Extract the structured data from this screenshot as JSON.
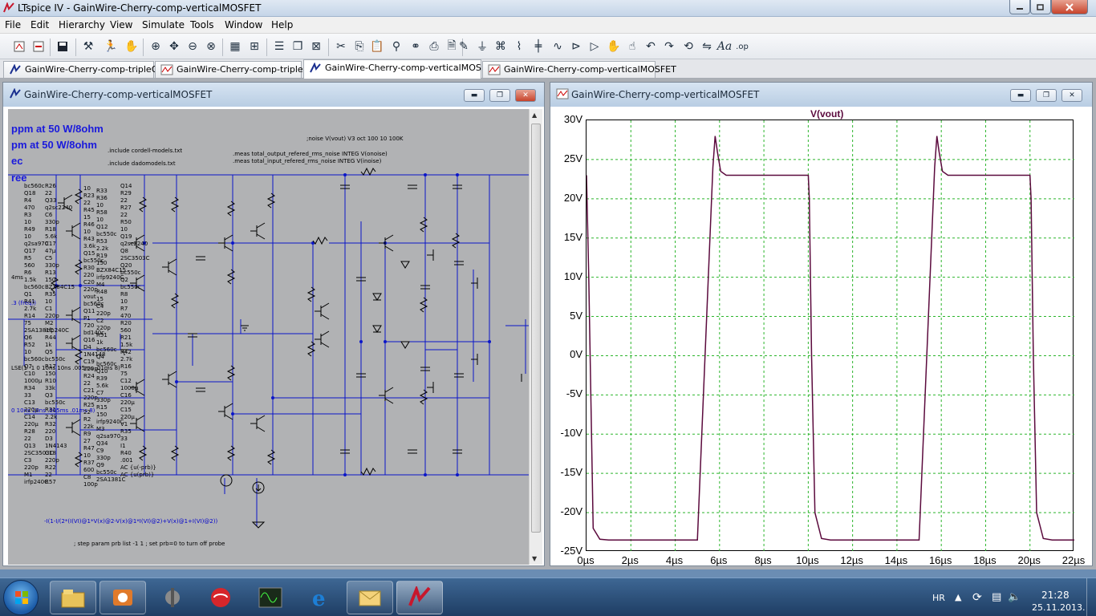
{
  "window": {
    "title": "LTspice IV - GainWire-Cherry-comp-verticalMOSFET"
  },
  "menu": [
    "File",
    "Edit",
    "Hierarchy",
    "View",
    "Simulate",
    "Tools",
    "Window",
    "Help"
  ],
  "toolbar_icons": [
    "new-schematic-icon",
    "open-icon",
    "save-icon",
    "control-panel-icon",
    "run-icon",
    "halt-icon",
    "zoom-in-icon",
    "pan-icon",
    "zoom-out-icon",
    "zoom-fit-icon",
    "autorange-icon",
    "tile-horizontal-icon",
    "cascade-icon",
    "close-all-icon",
    "cut-icon",
    "copy-icon",
    "paste-icon",
    "find-icon",
    "binoculars-icon",
    "print-icon",
    "print-preview-icon",
    "wire-icon",
    "ground-icon",
    "label-icon",
    "resistor-icon",
    "capacitor-icon",
    "inductor-icon",
    "diode-icon",
    "component-icon",
    "move-icon",
    "drag-icon",
    "undo-icon",
    "redo-icon",
    "rotate-icon",
    "mirror-icon",
    "text-icon",
    "spice-directive-icon"
  ],
  "tabs": [
    {
      "label": "GainWire-Cherry-comp-tripleOPS",
      "icon": "schematic-icon"
    },
    {
      "label": "GainWire-Cherry-comp-tripleOPS",
      "icon": "waveform-icon"
    },
    {
      "label": "GainWire-Cherry-comp-verticalMOSFET",
      "icon": "schematic-icon"
    },
    {
      "label": "GainWire-Cherry-comp-verticalMOSFET",
      "icon": "waveform-icon"
    }
  ],
  "schematic": {
    "title": "GainWire-Cherry-comp-verticalMOSFET",
    "big_text": [
      "ppm at 50 W/8ohm",
      "pm at 50 W/8ohm",
      "ec",
      "ree"
    ],
    "directives": [
      ".include cordell-models.txt",
      ".include dadomodels.txt",
      ";noise V(vout) V3 oct 100 10 100K",
      ".meas total_output_refered_rms_noise INTEG V(onoise)",
      ".meas total_input_refered_rms_noise INTEG V(inoise)",
      "-I(1-I/(2*(I(VI)@1*V(x)@2-V(x)@1*I(VI)@2)+V(x)@1+I(VI)@2))",
      "; step param prb list -1 1 ; set prb=0 to turn off probe"
    ],
    "side_labels": [
      "4ms",
      ".3 (freq))",
      "LSE(1 -1 0 10ns 10ns .005ms .01ms 8)",
      "0 10ns 10ns .005ms .01ms 8)"
    ],
    "component_labels": [
      "bc560c",
      "Q18",
      "R4",
      "470",
      "R3",
      "10",
      "R49",
      "10",
      "q2sa970",
      "Q17",
      "R5",
      "560",
      "R6",
      "1.5k",
      "bc560c",
      "Q1",
      "R41",
      "2.7k",
      "R14",
      "75",
      "2SA1381C",
      "Q6",
      "R52",
      "10",
      "bc560c",
      "Q7",
      "C10",
      "1000µ",
      "R34",
      "33",
      "C13",
      "220µ",
      "C14",
      "220µ",
      "R28",
      "22",
      "Q13",
      "2SC3503C",
      "C3",
      "220p",
      "M1",
      "irfp240C",
      "R26",
      "22",
      "Q33",
      "q2sc2240",
      "C6",
      "330p",
      "R18",
      "5.6k",
      "C17",
      "47µ",
      "C5",
      "330p",
      "R13",
      "150",
      "BZX84C15",
      "R35",
      "10",
      "C1",
      "220p",
      "M2",
      "irfp240C",
      "R44",
      "1k",
      "Q5",
      "bc550c",
      "R17",
      "150",
      "R10",
      "33k",
      "Q3",
      "bc550c",
      "R31",
      "2.2k",
      "R32",
      "220",
      "D3",
      "1N4143",
      "C18",
      "220p",
      "R22",
      "22",
      "R57",
      "10",
      "R23",
      "22",
      "R45",
      "15",
      "R46",
      "10",
      "R43",
      "3.6k",
      "Q15",
      "bc550c",
      "R30",
      "220",
      "C20",
      "220p",
      "vout",
      "bc560c",
      "Q11",
      "P1",
      "720",
      "bd140c",
      "Q16",
      "D4",
      "1N4148",
      "C19",
      "220p",
      "R24",
      "22",
      "C21",
      "220p",
      "R25",
      "22",
      "R2",
      "22k",
      "R9",
      "27",
      "R47",
      "10",
      "R37",
      "600",
      "C8",
      "100p",
      "R33",
      "R36",
      "10",
      "R58",
      "10",
      "Q12",
      "bc550c",
      "R53",
      "2.2k",
      "R19",
      "150",
      "BZX84C15",
      "irfp9240C",
      "M4",
      "R48",
      "15",
      "C4",
      "220p",
      "C2",
      "220p",
      "R51",
      "1k",
      "bc560c",
      "Q4",
      "bc560c",
      "Q10",
      "R39",
      "5.6k",
      "C7",
      "330p",
      "R15",
      "150",
      "irfp9240C",
      "M3",
      "q2sa970",
      "Q34",
      "C9",
      "330p",
      "Q9",
      "bc550c",
      "2SA1381C",
      "Q14",
      "R29",
      "22",
      "R27",
      "22",
      "R50",
      "10",
      "Q19",
      "q2sc2240",
      "Q8",
      "2SC3503C",
      "Q20",
      "bc550c",
      "Q2",
      "bc550c",
      "R8",
      "10",
      "R7",
      "470",
      "R20",
      "560",
      "R21",
      "1.5k",
      "R42",
      "2.7k",
      "R16",
      "75",
      "C12",
      "1000µ",
      "C16",
      "220µ",
      "C15",
      "220µ",
      "V1",
      "R35",
      "33",
      "I1",
      "R40",
      ".001",
      "AC {u(-prb)}",
      "AC {u(prb)}"
    ]
  },
  "waveform": {
    "title": "GainWire-Cherry-comp-verticalMOSFET",
    "trace_name": "V(vout)"
  },
  "chart_data": {
    "type": "line",
    "series": [
      {
        "name": "V(vout)",
        "x": [
          0,
          0.1,
          0.3,
          0.6,
          1.0,
          2.0,
          5.0,
          5.7,
          5.8,
          5.9,
          6.05,
          6.3,
          7.0,
          10.0,
          10.05,
          10.15,
          10.3,
          10.6,
          11.0,
          12.0,
          15.0,
          15.7,
          15.8,
          15.9,
          16.05,
          16.3,
          17.0,
          20.0,
          20.05,
          20.15,
          20.3,
          20.6,
          21.0,
          22.0
        ],
        "y": [
          23.0,
          10.0,
          -22.0,
          -23.4,
          -23.5,
          -23.5,
          -23.5,
          24.0,
          28.0,
          26.0,
          23.5,
          23.0,
          23.0,
          23.0,
          20.0,
          0.0,
          -20.0,
          -23.3,
          -23.5,
          -23.5,
          -23.5,
          24.0,
          28.0,
          26.0,
          23.5,
          23.0,
          23.0,
          23.0,
          20.0,
          0.0,
          -20.0,
          -23.3,
          -23.5,
          -23.5
        ]
      }
    ],
    "x_ticks": [
      "0µs",
      "2µs",
      "4µs",
      "6µs",
      "8µs",
      "10µs",
      "12µs",
      "14µs",
      "16µs",
      "18µs",
      "20µs",
      "22µs"
    ],
    "y_ticks": [
      "30V",
      "25V",
      "20V",
      "15V",
      "10V",
      "5V",
      "0V",
      "-5V",
      "-10V",
      "-15V",
      "-20V",
      "-25V"
    ],
    "xlim": [
      0,
      22
    ],
    "ylim": [
      -25,
      30
    ],
    "grid": true,
    "colors": {
      "trace": "#5b0a3d",
      "grid": "#2bb52b"
    }
  },
  "taskbar": {
    "apps": [
      "explorer-icon",
      "media-icon",
      "device-icon",
      "antivirus-icon",
      "oscilloscope-icon",
      "internet-explorer-icon",
      "mail-icon",
      "ltspice-icon"
    ],
    "language": "HR",
    "time": "21:28",
    "date": "25.11.2013."
  }
}
